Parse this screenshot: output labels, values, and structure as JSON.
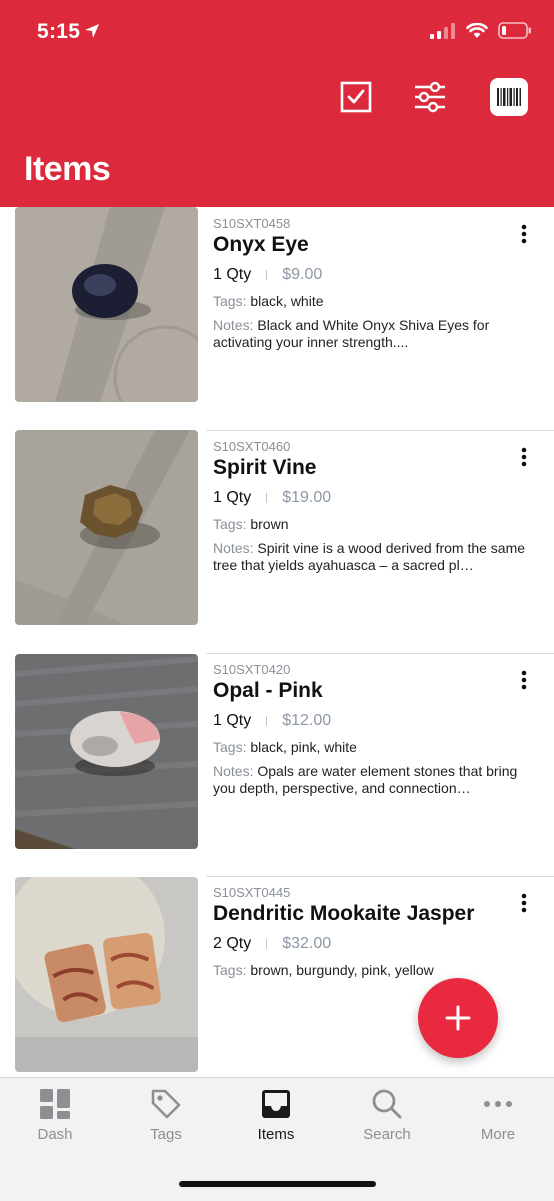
{
  "status": {
    "time": "5:15"
  },
  "header": {
    "title": "Items",
    "icons": [
      "checkbox-icon",
      "filter-sliders-icon",
      "barcode-icon"
    ]
  },
  "items": [
    {
      "sku": "S10SXT0458",
      "name": "Onyx Eye",
      "qty": "1 Qty",
      "price": "$9.00",
      "tags_label": "Tags:",
      "tags": "black, white",
      "notes_label": "Notes:",
      "notes": "Black and White Onyx Shiva Eyes for activating your inner strength...."
    },
    {
      "sku": "S10SXT0460",
      "name": "Spirit Vine",
      "qty": "1 Qty",
      "price": "$19.00",
      "tags_label": "Tags:",
      "tags": "brown",
      "notes_label": "Notes:",
      "notes": "Spirit vine is a wood derived from the same tree that yields ayahuasca – a sacred pl…"
    },
    {
      "sku": "S10SXT0420",
      "name": "Opal - Pink",
      "qty": "1 Qty",
      "price": "$12.00",
      "tags_label": "Tags:",
      "tags": "black, pink, white",
      "notes_label": "Notes:",
      "notes": "Opals are water element stones that bring you depth, perspective, and connection…"
    },
    {
      "sku": "S10SXT0445",
      "name": "Dendritic Mookaite Jasper",
      "qty": "2 Qty",
      "price": "$32.00",
      "tags_label": "Tags:",
      "tags": "brown, burgundy, pink, yellow"
    }
  ],
  "tabs": [
    {
      "label": "Dash",
      "icon": "dashboard-grid-icon"
    },
    {
      "label": "Tags",
      "icon": "tag-icon"
    },
    {
      "label": "Items",
      "icon": "inbox-tray-icon",
      "active": true
    },
    {
      "label": "Search",
      "icon": "search-icon"
    },
    {
      "label": "More",
      "icon": "ellipsis-icon"
    }
  ],
  "colors": {
    "accent": "#dc2a3c",
    "fab": "#e8293f",
    "price": "#8d98a4"
  }
}
